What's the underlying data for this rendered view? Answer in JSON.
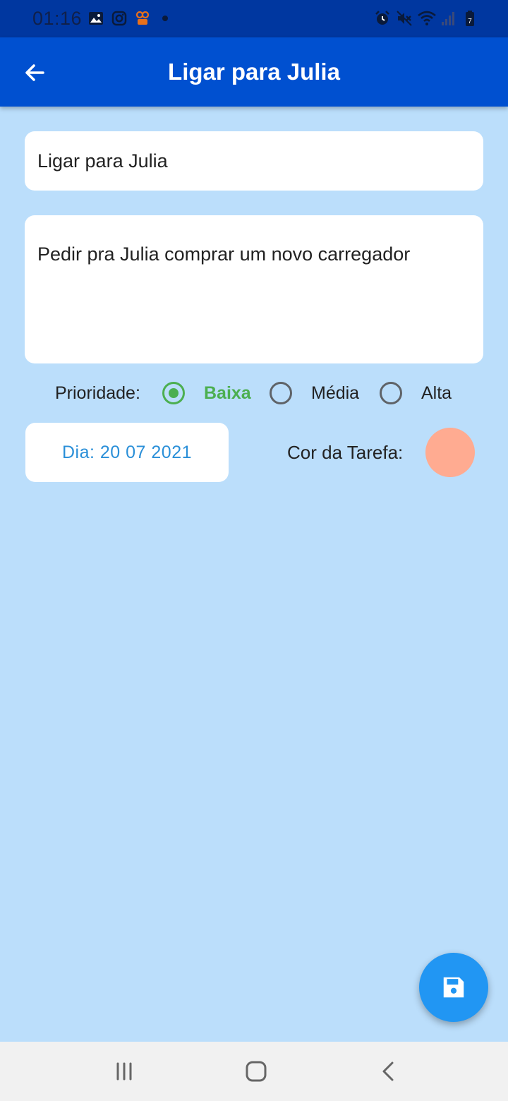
{
  "status_bar": {
    "time": "01:16",
    "icons": [
      "gallery-icon",
      "instagram-icon",
      "app-icon",
      "dot-icon",
      "alarm-icon",
      "mute-icon",
      "wifi-icon",
      "signal-icon",
      "battery-icon"
    ],
    "battery_level": "7"
  },
  "app_bar": {
    "title": "Ligar para Julia",
    "back_icon": "arrow-left-icon"
  },
  "form": {
    "title_value": "Ligar para Julia",
    "description_value": "Pedir pra Julia comprar um novo carregador"
  },
  "priority": {
    "label": "Prioridade:",
    "options": [
      {
        "label": "Baixa",
        "selected": true
      },
      {
        "label": "Média",
        "selected": false
      },
      {
        "label": "Alta",
        "selected": false
      }
    ]
  },
  "date_button": {
    "label": "Dia: 20 07 2021"
  },
  "task_color": {
    "label": "Cor da Tarefa:",
    "value": "#ffab91"
  },
  "fab": {
    "icon": "save-icon"
  },
  "colors": {
    "status_bar": "#0037a0",
    "app_bar": "#0050d0",
    "background": "#bbdefb",
    "accent_green": "#4caf50",
    "fab": "#2196f3",
    "date_text": "#2a8fd8"
  },
  "nav_bar": {
    "icons": [
      "recent-apps-icon",
      "home-icon",
      "back-nav-icon"
    ]
  }
}
